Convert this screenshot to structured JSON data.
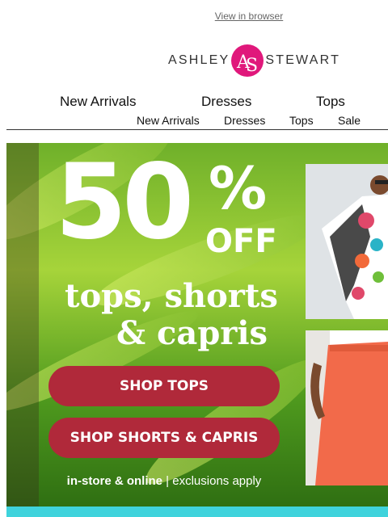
{
  "header": {
    "view_in_browser": "View in browser"
  },
  "brand": {
    "left": "ASHLEY",
    "right": "STEWART",
    "mark_color": "#e0187b"
  },
  "nav_primary": [
    "New Arrivals",
    "Dresses",
    "Tops"
  ],
  "nav_secondary": [
    "New Arrivals",
    "Dresses",
    "Tops",
    "Sale"
  ],
  "hero": {
    "percent": "50",
    "percent_sign": "%",
    "off": "OFF",
    "line1": "tops, shorts",
    "line2": "& capris",
    "btn_tops": "SHOP TOPS",
    "btn_shorts": "SHOP SHORTS & CAPRIS",
    "footnote_bold": "in-store & online",
    "footnote_rest": " | exclusions apply",
    "button_color": "#b0293a"
  }
}
